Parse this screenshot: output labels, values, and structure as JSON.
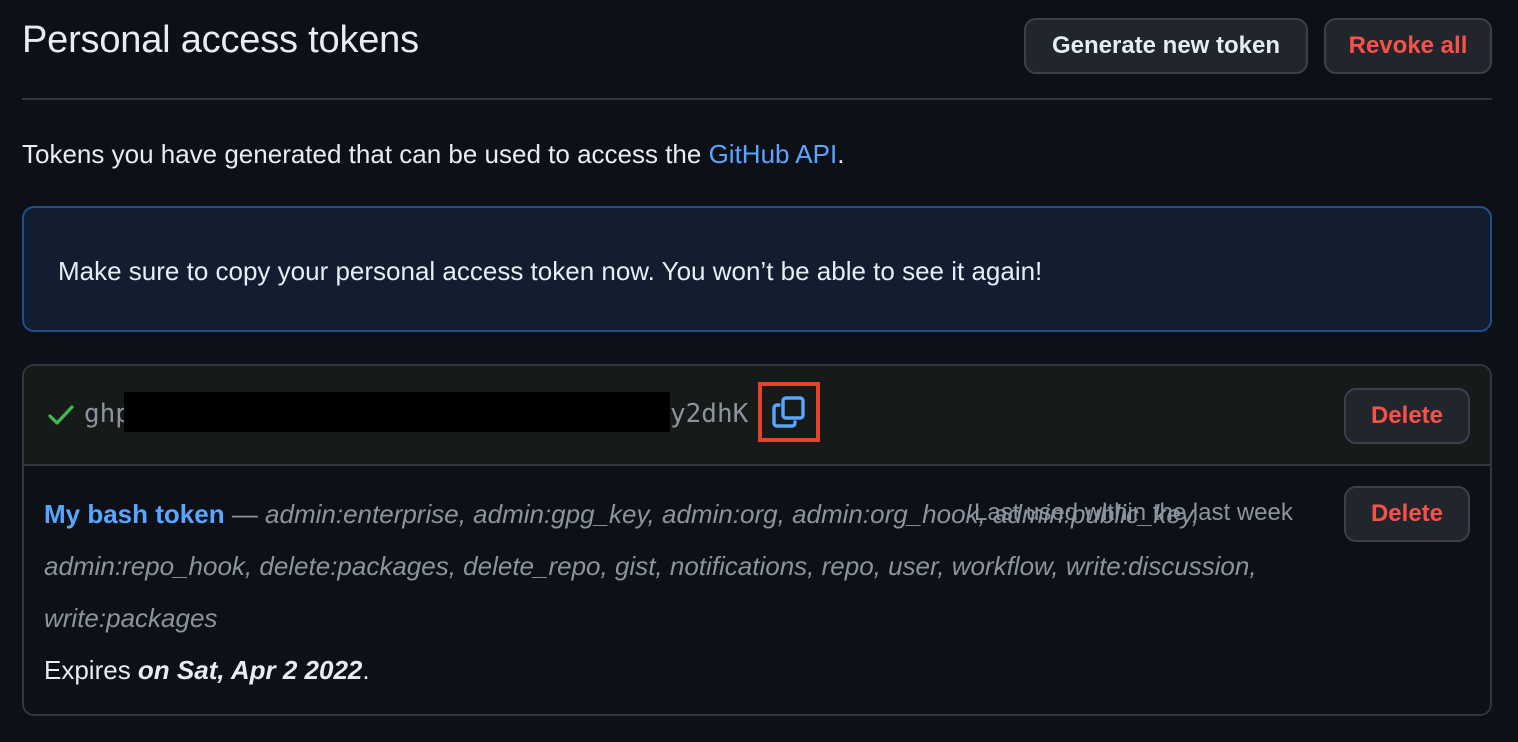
{
  "header": {
    "title": "Personal access tokens",
    "generate_label": "Generate new token",
    "revoke_label": "Revoke all"
  },
  "intro": {
    "text_before": "Tokens you have generated that can be used to access the ",
    "link_text": "GitHub API",
    "text_after": "."
  },
  "flash": {
    "message": "Make sure to copy your personal access token now. You won’t be able to see it again!"
  },
  "new_token": {
    "prefix": "ghp",
    "suffix": "y2dhK",
    "delete_label": "Delete",
    "icons": [
      "check-icon",
      "copy-icon"
    ],
    "colors": {
      "check": "#3fb950",
      "copy_icon": "#58a6ff",
      "highlight_box": "#e5432a"
    }
  },
  "token": {
    "name": "My bash token",
    "separator": " — ",
    "scopes": "admin:enterprise, admin:gpg_key, admin:org, admin:org_hook, admin:public_key, admin:repo_hook, delete:packages, delete_repo, gist, notifications, repo, user, workflow, write:discussion, write:packages",
    "last_used": "Last used within the last week",
    "delete_label": "Delete",
    "expires_prefix": "Expires ",
    "expires_date": "on Sat, Apr 2 2022",
    "expires_suffix": "."
  },
  "colors": {
    "background": "#0d1117",
    "link": "#58a6ff",
    "danger": "#f85149",
    "flash_bg": "#121d2f",
    "flash_border": "#1f4f91"
  }
}
